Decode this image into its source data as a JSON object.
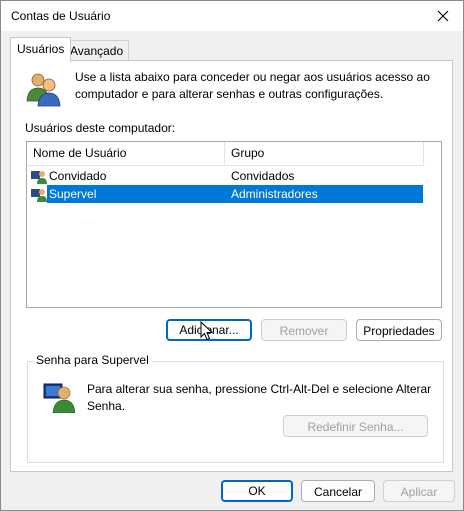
{
  "window": {
    "title": "Contas de Usuário"
  },
  "tabs": [
    {
      "label": "Usuários",
      "active": true
    },
    {
      "label": "Avançado",
      "active": false
    }
  ],
  "intro_text": "Use a lista abaixo para conceder ou negar aos usuários acesso ao computador e para alterar senhas e outras configurações.",
  "list_label": "Usuários deste computador:",
  "columns": [
    "Nome de Usuário",
    "Grupo"
  ],
  "users": [
    {
      "name": "Convidado",
      "group": "Convidados",
      "selected": false
    },
    {
      "name": "Supervel",
      "group": "Administradores",
      "selected": true
    }
  ],
  "buttons": {
    "add": "Adicionar...",
    "remove": "Remover",
    "properties": "Propriedades"
  },
  "password_group": {
    "label": "Senha para Supervel",
    "text": "Para alterar sua senha, pressione Ctrl-Alt-Del e selecione Alterar Senha.",
    "reset_button": "Redefinir Senha..."
  },
  "footer": {
    "ok": "OK",
    "cancel": "Cancelar",
    "apply": "Aplicar"
  },
  "colors": {
    "selection": "#0078d7",
    "accent_border": "#0067c0"
  }
}
